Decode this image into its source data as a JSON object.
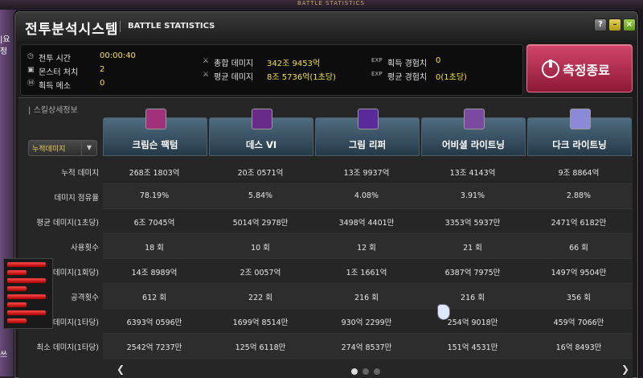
{
  "background": {
    "top_text": "BATTLE STATISTICS",
    "left_texts": [
      "|요정",
      "쓰"
    ]
  },
  "window": {
    "title_ko": "전투분석시스템",
    "title_en": "BATTLE STATISTICS",
    "help_label": "?",
    "min_label": "–",
    "close_label": "×"
  },
  "summary": {
    "battle_time_label": "전투 시간",
    "battle_time": "00:00:40",
    "monster_kills_label": "몬스터 처치",
    "monster_kills": "2",
    "meso_label": "획득 메소",
    "meso": "0",
    "total_damage_label": "총합 데미지",
    "total_damage": "342조 9453억",
    "avg_damage_label": "평균 데미지",
    "avg_damage": "8조 5736억(1초당)",
    "exp_label": "획득 경험치",
    "exp": "0",
    "avg_exp_label": "평균 경험치",
    "avg_exp": "0(1초당)",
    "exp_prefix": "EXP"
  },
  "stop_button": {
    "label": "측정종료"
  },
  "detail": {
    "section_label": "| 스킬상세정보",
    "metric_selected": "누적데미지",
    "skills": [
      {
        "name": "크림슨 팩텀",
        "color": "#a0307a"
      },
      {
        "name": "데스 VI",
        "color": "#6a2a8a"
      },
      {
        "name": "그림 리퍼",
        "color": "#5a2a9a"
      },
      {
        "name": "어비셜 라이트닝",
        "color": "#7a4aa0"
      },
      {
        "name": "다크 라이트닝",
        "color": "#8a8ad8"
      }
    ],
    "rows": [
      {
        "label": "누적 데미지",
        "values": [
          "268조 1803억",
          "20조 0571억",
          "13조 9937억",
          "13조 4143억",
          "9조 8864억"
        ]
      },
      {
        "label": "데미지 점유율",
        "values": [
          "78.19%",
          "5.84%",
          "4.08%",
          "3.91%",
          "2.88%"
        ]
      },
      {
        "label": "평균 데미지(1초당)",
        "values": [
          "6조 7045억",
          "5014억 2978만",
          "3498억 4401만",
          "3353억 5937만",
          "2471억 6182만"
        ]
      },
      {
        "label": "사용횟수",
        "values": [
          "18 회",
          "10 회",
          "12 회",
          "21 회",
          "66 회"
        ]
      },
      {
        "label": "균 데미지(1회당)",
        "values": [
          "14조 8989억",
          "2조 0057억",
          "1조 1661억",
          "6387억 7975만",
          "1497억 9504만"
        ]
      },
      {
        "label": "공격횟수",
        "values": [
          "612 회",
          "222 회",
          "216 회",
          "216 회",
          "356 회"
        ]
      },
      {
        "label": "데미지(1타당)",
        "values": [
          "6393억 0596만",
          "1699억 8514만",
          "930억 2299만",
          "254억 9018만",
          "459억 7066만"
        ]
      },
      {
        "label": "최소 데미지(1타당)",
        "values": [
          "2542억 7237만",
          "125억 6118만",
          "274억 8537만",
          "151억 4531만",
          "16억 8493만"
        ]
      }
    ],
    "prev_arrow": "❮",
    "next_arrow": "❯"
  }
}
